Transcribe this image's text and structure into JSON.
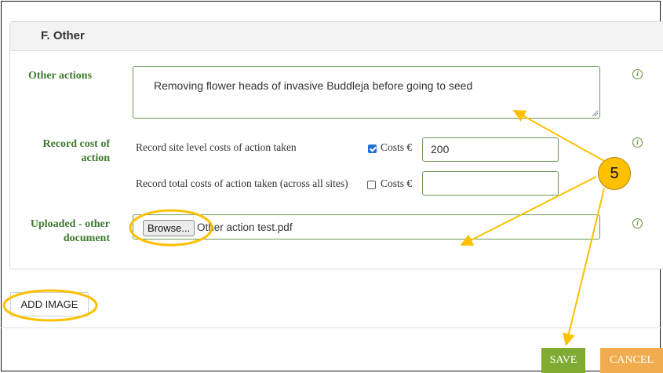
{
  "section": {
    "title": "F. Other"
  },
  "other_actions": {
    "label": "Other actions",
    "value": "Removing flower heads of invasive Buddleja before going to seed"
  },
  "record_cost": {
    "label_line1": "Record cost of",
    "label_line2": "action",
    "site_level": {
      "label": "Record site level costs of action taken",
      "checked": true,
      "costs_label": "Costs €",
      "value": "200"
    },
    "total": {
      "label": "Record total costs of action taken (across all sites)",
      "checked": false,
      "costs_label": "Costs €",
      "value": ""
    }
  },
  "uploaded": {
    "label_line1": "Uploaded - other",
    "label_line2": "document",
    "browse_label": "Browse...",
    "filename": "Other action test.pdf"
  },
  "buttons": {
    "add_image": "ADD IMAGE",
    "save": "SAVE",
    "cancel": "CANCEL"
  },
  "annotation": {
    "badge": "5",
    "color": "#ffc000"
  },
  "icons": {
    "info": "info-icon",
    "resize": "resize-grip-icon"
  },
  "colors": {
    "label_green": "#3d7a2e",
    "save_green": "#7fab33",
    "cancel_orange": "#f0ac4e",
    "checkbox_blue": "#1e6fd6"
  }
}
